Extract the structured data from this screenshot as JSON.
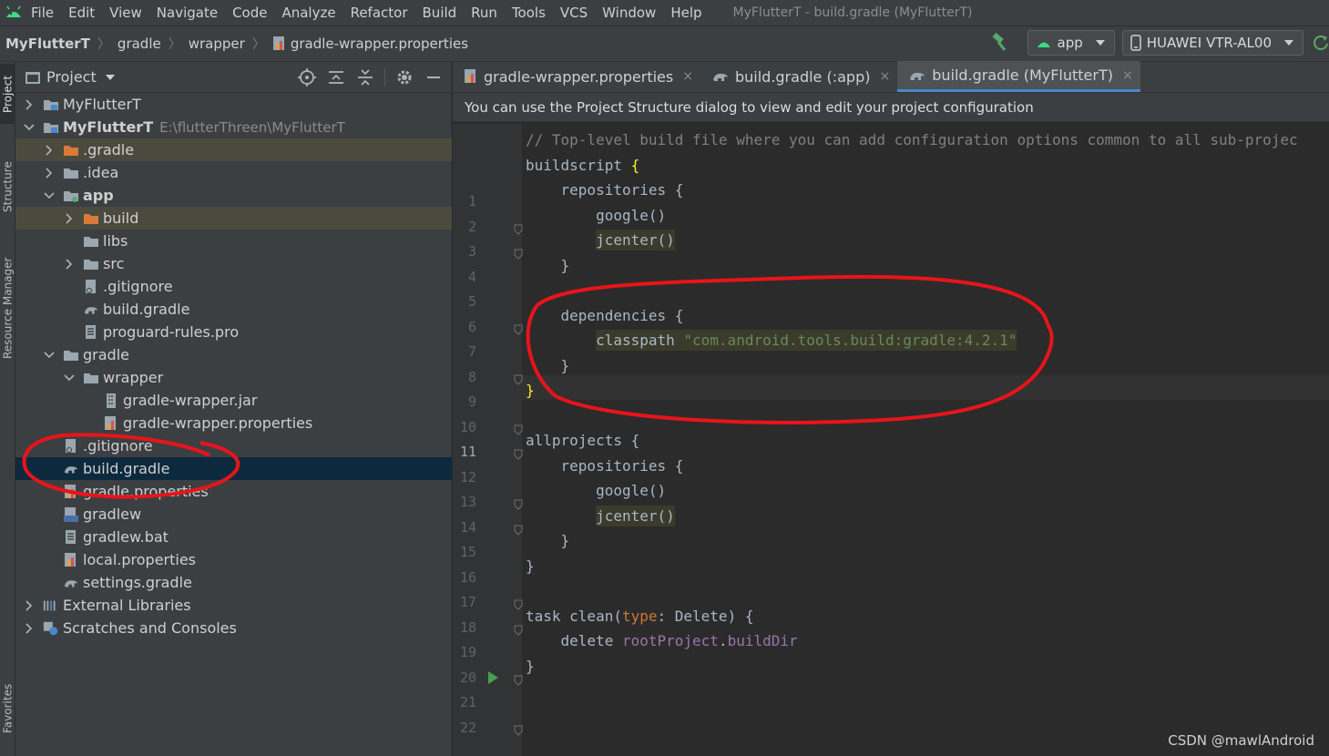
{
  "menubar": {
    "items": [
      "File",
      "Edit",
      "View",
      "Navigate",
      "Code",
      "Analyze",
      "Refactor",
      "Build",
      "Run",
      "Tools",
      "VCS",
      "Window",
      "Help"
    ],
    "window_title": "MyFlutterT - build.gradle (MyFlutterT)"
  },
  "navbar": {
    "crumbs": [
      "MyFlutterT",
      "gradle",
      "wrapper",
      "gradle-wrapper.properties"
    ],
    "run_config": "app",
    "device": "HUAWEI VTR-AL00"
  },
  "left_strip": {
    "tabs": [
      "Project",
      "Structure",
      "Resource Manager",
      "Favorites"
    ]
  },
  "project_panel": {
    "title": "Project",
    "tree": [
      {
        "label": "MyFlutterT",
        "depth": 0,
        "expand": "collapsed",
        "icon": "module-icon"
      },
      {
        "label": "MyFlutterT",
        "path": "E:\\flutterThreen\\MyFlutterT",
        "depth": 0,
        "expand": "expanded",
        "icon": "module-folder-icon",
        "bold": true
      },
      {
        "label": ".gradle",
        "depth": 1,
        "expand": "collapsed",
        "icon": "orange-folder-icon",
        "highlight": true
      },
      {
        "label": ".idea",
        "depth": 1,
        "expand": "collapsed",
        "icon": "folder-icon"
      },
      {
        "label": "app",
        "depth": 1,
        "expand": "expanded",
        "icon": "app-module-icon",
        "bold": true
      },
      {
        "label": "build",
        "depth": 2,
        "expand": "collapsed",
        "icon": "orange-folder-icon",
        "highlight": true
      },
      {
        "label": "libs",
        "depth": 2,
        "expand": "none",
        "icon": "folder-icon"
      },
      {
        "label": "src",
        "depth": 2,
        "expand": "collapsed",
        "icon": "folder-icon"
      },
      {
        "label": ".gitignore",
        "depth": 2,
        "expand": "none",
        "icon": "gitignore-icon"
      },
      {
        "label": "build.gradle",
        "depth": 2,
        "expand": "none",
        "icon": "gradle-icon"
      },
      {
        "label": "proguard-rules.pro",
        "depth": 2,
        "expand": "none",
        "icon": "text-file-icon"
      },
      {
        "label": "gradle",
        "depth": 1,
        "expand": "expanded",
        "icon": "folder-icon"
      },
      {
        "label": "wrapper",
        "depth": 2,
        "expand": "expanded",
        "icon": "folder-icon"
      },
      {
        "label": "gradle-wrapper.jar",
        "depth": 3,
        "expand": "none",
        "icon": "jar-icon"
      },
      {
        "label": "gradle-wrapper.properties",
        "depth": 3,
        "expand": "none",
        "icon": "properties-icon"
      },
      {
        "label": ".gitignore",
        "depth": 1,
        "expand": "none",
        "icon": "gitignore-icon"
      },
      {
        "label": "build.gradle",
        "depth": 1,
        "expand": "none",
        "icon": "gradle-icon",
        "selected": true
      },
      {
        "label": "gradle.properties",
        "depth": 1,
        "expand": "none",
        "icon": "properties-icon"
      },
      {
        "label": "gradlew",
        "depth": 1,
        "expand": "none",
        "icon": "shell-file-icon"
      },
      {
        "label": "gradlew.bat",
        "depth": 1,
        "expand": "none",
        "icon": "text-file-icon"
      },
      {
        "label": "local.properties",
        "depth": 1,
        "expand": "none",
        "icon": "properties-icon"
      },
      {
        "label": "settings.gradle",
        "depth": 1,
        "expand": "none",
        "icon": "gradle-icon"
      },
      {
        "label": "External Libraries",
        "depth": 0,
        "expand": "collapsed",
        "icon": "libraries-icon"
      },
      {
        "label": "Scratches and Consoles",
        "depth": 0,
        "expand": "collapsed",
        "icon": "scratches-icon"
      }
    ]
  },
  "editor": {
    "tabs": [
      {
        "label": "gradle-wrapper.properties",
        "icon": "properties-icon",
        "active": false
      },
      {
        "label": "build.gradle (:app)",
        "icon": "gradle-icon",
        "active": false
      },
      {
        "label": "build.gradle (MyFlutterT)",
        "icon": "gradle-icon",
        "active": true
      }
    ],
    "banner": "You can use the Project Structure dialog to view and edit your project configuration",
    "current_line": 11,
    "lines": [
      {
        "n": "1",
        "parts": [
          {
            "t": "// Top-level build file where you can add configuration options common to all sub-projec",
            "c": "comment"
          }
        ]
      },
      {
        "n": "2",
        "parts": [
          {
            "t": "buildscript ",
            "c": ""
          },
          {
            "t": "{",
            "c": "brace-hl"
          }
        ]
      },
      {
        "n": "3",
        "parts": [
          {
            "t": "    repositories {",
            "c": ""
          }
        ]
      },
      {
        "n": "4",
        "parts": [
          {
            "t": "        google()",
            "c": ""
          }
        ]
      },
      {
        "n": "5",
        "parts": [
          {
            "t": "        ",
            "c": ""
          },
          {
            "t": "jcenter()",
            "c": "hl-bg"
          }
        ]
      },
      {
        "n": "6",
        "parts": [
          {
            "t": "    }",
            "c": ""
          }
        ]
      },
      {
        "n": "7",
        "parts": []
      },
      {
        "n": "8",
        "parts": [
          {
            "t": "    dependencies {",
            "c": ""
          }
        ]
      },
      {
        "n": "9",
        "parts": [
          {
            "t": "        ",
            "c": ""
          },
          {
            "t": "classpath ",
            "c": "hl-bg"
          },
          {
            "t": "\"com.android.tools.build:gradle:4.2.1\"",
            "c": "str hl-bg"
          }
        ]
      },
      {
        "n": "10",
        "parts": [
          {
            "t": "    }",
            "c": ""
          }
        ]
      },
      {
        "n": "11",
        "parts": [
          {
            "t": "}",
            "c": "brace-hl"
          }
        ]
      },
      {
        "n": "12",
        "parts": []
      },
      {
        "n": "13",
        "parts": [
          {
            "t": "allprojects {",
            "c": ""
          }
        ]
      },
      {
        "n": "14",
        "parts": [
          {
            "t": "    repositories {",
            "c": ""
          }
        ]
      },
      {
        "n": "15",
        "parts": [
          {
            "t": "        google()",
            "c": ""
          }
        ]
      },
      {
        "n": "16",
        "parts": [
          {
            "t": "        ",
            "c": ""
          },
          {
            "t": "jcenter()",
            "c": "hl-bg"
          }
        ]
      },
      {
        "n": "17",
        "parts": [
          {
            "t": "    }",
            "c": ""
          }
        ]
      },
      {
        "n": "18",
        "parts": [
          {
            "t": "}",
            "c": ""
          }
        ]
      },
      {
        "n": "19",
        "parts": []
      },
      {
        "n": "20",
        "parts": [
          {
            "t": "task clean(",
            "c": ""
          },
          {
            "t": "type",
            "c": "param"
          },
          {
            "t": ": Delete) {",
            "c": ""
          }
        ]
      },
      {
        "n": "21",
        "parts": [
          {
            "t": "    delete ",
            "c": ""
          },
          {
            "t": "rootProject",
            "c": "kw-purple"
          },
          {
            "t": ".",
            "c": ""
          },
          {
            "t": "buildDir",
            "c": "kw-purple"
          }
        ]
      },
      {
        "n": "22",
        "parts": [
          {
            "t": "}",
            "c": ""
          }
        ]
      }
    ]
  },
  "watermark": "CSDN @mawlAndroid",
  "colors": {
    "annotation_red": "#e8141b",
    "selection": "#0d293e",
    "ignored_highlight": "#4b4a3f"
  }
}
